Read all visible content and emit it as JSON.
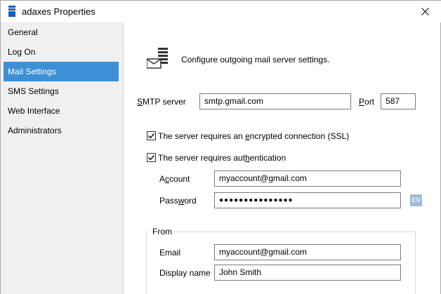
{
  "window": {
    "title": "adaxes Properties",
    "close_glyph": "✕"
  },
  "sidebar": {
    "items": [
      {
        "label": "General",
        "active": false
      },
      {
        "label": "Log On",
        "active": false
      },
      {
        "label": "Mail Settings",
        "active": true
      },
      {
        "label": "SMS Settings",
        "active": false
      },
      {
        "label": "Web Interface",
        "active": false
      },
      {
        "label": "Administrators",
        "active": false
      }
    ]
  },
  "main": {
    "header_text": "Configure outgoing mail server settings.",
    "header_icon": "mail-server-icon",
    "smtp": {
      "label_prefix": "S",
      "label_rest": "MTP server",
      "value": "smtp.gmail.com",
      "port_label_prefix": "P",
      "port_label_rest": "ort",
      "port_value": "587"
    },
    "ssl": {
      "checked": true,
      "label_before": "The server requires an ",
      "label_underlined": "e",
      "label_after": "ncrypted connection (SSL)"
    },
    "auth": {
      "checked": true,
      "label_before": "The server requires aut",
      "label_underlined": "h",
      "label_after": "entication",
      "account_label_prefix": "A",
      "account_label_underlined": "c",
      "account_label_rest": "count",
      "account_value": "myaccount@gmail.com",
      "password_label_before": "Pass",
      "password_label_underlined": "w",
      "password_label_after": "ord",
      "password_value": "●●●●●●●●●●●●●●●",
      "input_language": "EN"
    },
    "from": {
      "caption": "From",
      "email_label": "Email",
      "email_value": "myaccount@gmail.com",
      "display_name_label": "Display name",
      "display_name_value": "John Smith"
    }
  },
  "colors": {
    "accent": "#3d8fd6",
    "en_badge": "#9fbad8"
  }
}
